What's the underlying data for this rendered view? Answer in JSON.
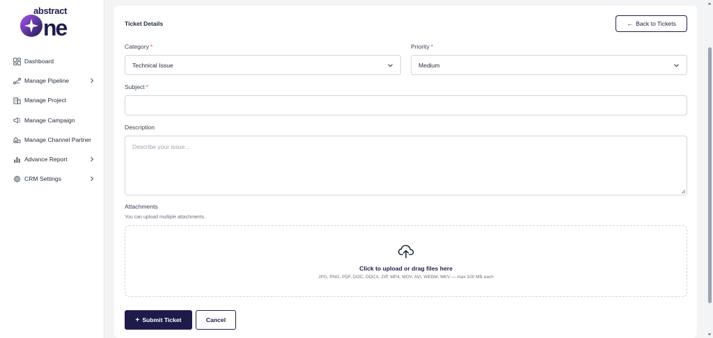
{
  "brand": {
    "top": "abstract",
    "word": "one"
  },
  "sidebar": {
    "items": [
      {
        "label": "Dashboard",
        "icon": "grid-icon",
        "has_submenu": false
      },
      {
        "label": "Manage Pipeline",
        "icon": "pipeline-icon",
        "has_submenu": true
      },
      {
        "label": "Manage Project",
        "icon": "building-icon",
        "has_submenu": false
      },
      {
        "label": "Manage Campaign",
        "icon": "megaphone-icon",
        "has_submenu": false
      },
      {
        "label": "Manage Channel Partner",
        "icon": "partner-icon",
        "has_submenu": false
      },
      {
        "label": "Advance Report",
        "icon": "bar-chart-icon",
        "has_submenu": true
      },
      {
        "label": "CRM Settings",
        "icon": "gear-icon",
        "has_submenu": true
      }
    ]
  },
  "form": {
    "title": "Ticket Details",
    "back_label": "Back to Tickets",
    "category": {
      "label": "Category",
      "required_mark": "*",
      "value": "Technical Issue"
    },
    "priority": {
      "label": "Priority",
      "required_mark": "*",
      "value": "Medium"
    },
    "subject": {
      "label": "Subject",
      "required_mark": "*",
      "value": ""
    },
    "description": {
      "label": "Description",
      "placeholder": "Describe your issue..."
    },
    "attachments": {
      "label": "Attachments",
      "hint": "You can upload multiple attachments.",
      "dropzone_main": "Click to upload or drag files here",
      "dropzone_sub": "JPG, PNG, PDF, DOC, DOCX, ZIP, MP4, MOV, AVI, WEBM, MKV — max 100 MB each"
    },
    "submit_label": "Submit Ticket",
    "submit_icon": "+",
    "cancel_label": "Cancel"
  },
  "colors": {
    "brand_navy": "#1e1b4b",
    "required": "#ef4444",
    "logo_gradient_start": "#7c3aed",
    "logo_gradient_end": "#1e1b4b"
  }
}
